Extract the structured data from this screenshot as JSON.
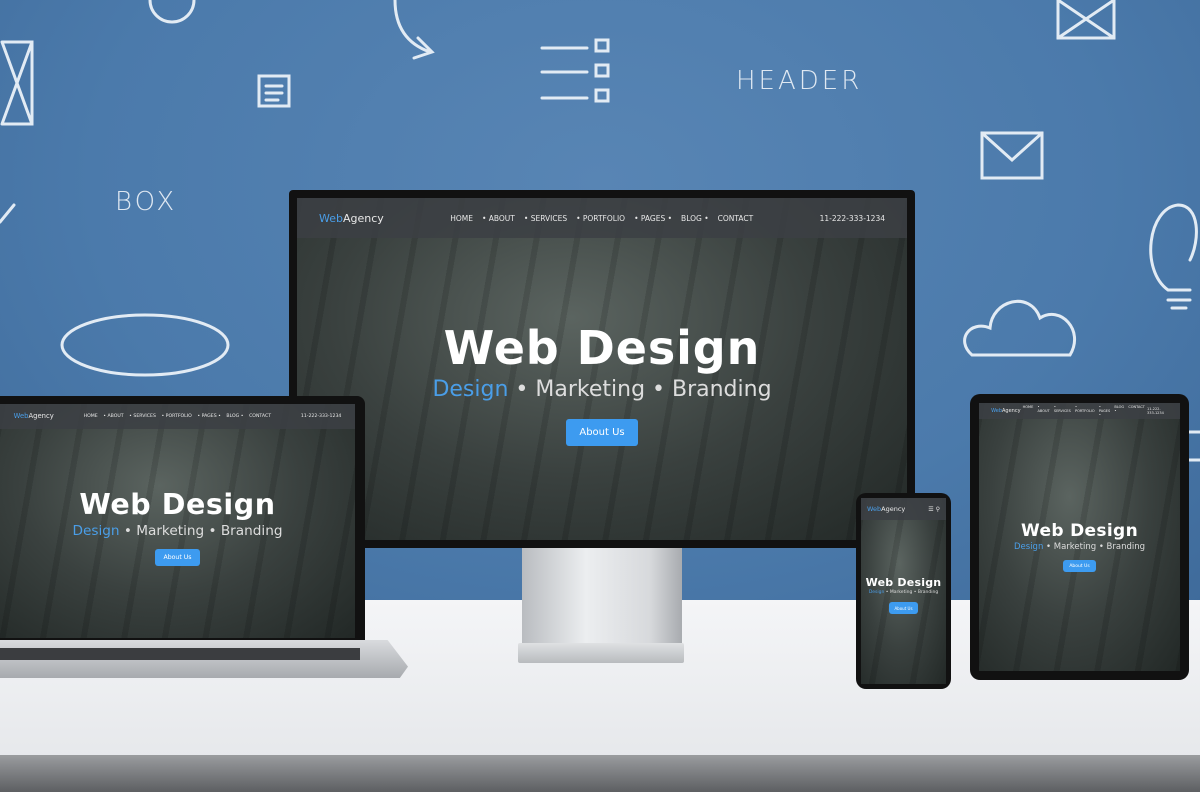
{
  "wall": {
    "labels": [
      "HEADER",
      "BOX"
    ]
  },
  "site": {
    "brand_a": "Web",
    "brand_b": "Agency",
    "nav": [
      "HOME",
      "• ABOUT",
      "• SERVICES",
      "• PORTFOLIO",
      "• PAGES •",
      "BLOG •",
      "CONTACT"
    ],
    "phone": "11-222-333-1234",
    "hero_title": "Web Design",
    "sub_design": "Design",
    "sub_rest": " • Marketing • Branding",
    "button": "About Us",
    "accent": "#3d9bf0"
  },
  "phone_icons": [
    "menu-icon",
    "search-icon"
  ]
}
